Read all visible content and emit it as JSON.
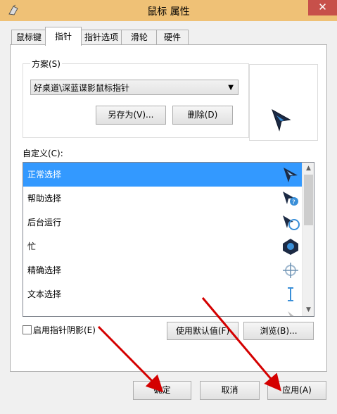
{
  "window": {
    "title": "鼠标 属性",
    "close": "✕"
  },
  "tabs": [
    "鼠标键",
    "指针",
    "指针选项",
    "滑轮",
    "硬件"
  ],
  "scheme": {
    "label": "方案(S)",
    "selected": "好桌道\\深蓝谍影鼠标指针",
    "save_as": "另存为(V)...",
    "delete": "删除(D)"
  },
  "customize": {
    "label": "自定义(C):",
    "items": [
      "正常选择",
      "帮助选择",
      "后台运行",
      "忙",
      "精确选择",
      "文本选择"
    ]
  },
  "shadow": {
    "label": "启用指针阴影(E)"
  },
  "buttons": {
    "use_default": "使用默认值(F)",
    "browse": "浏览(B)...",
    "ok": "确定",
    "cancel": "取消",
    "apply": "应用(A)"
  },
  "colors": {
    "selection": "#3399ff",
    "title_bar": "#efc176",
    "close": "#c7504a",
    "arrow": "#d40000"
  }
}
